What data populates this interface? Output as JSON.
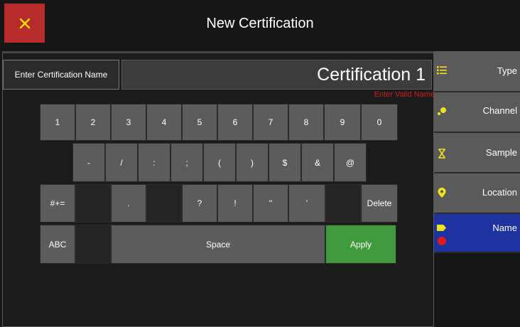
{
  "header": {
    "title": "New Certification",
    "close_icon": "close-icon"
  },
  "name_entry": {
    "label": "Enter Certification Name",
    "value": "Certification 1",
    "error": "Enter Valid Name"
  },
  "keyboard": {
    "row1": [
      "1",
      "2",
      "3",
      "4",
      "5",
      "6",
      "7",
      "8",
      "9",
      "0"
    ],
    "row2": [
      "-",
      "/",
      ":",
      ";",
      "(",
      ")",
      "$",
      "&",
      "@"
    ],
    "row3": [
      "#+=",
      "",
      ".",
      "",
      "?",
      "!",
      "\"",
      "'",
      "",
      "Delete"
    ],
    "row4": {
      "abc": "ABC",
      "space": "Space",
      "apply": "Apply"
    }
  },
  "sidebar": {
    "items": [
      {
        "label": "Type",
        "icon": "list-icon"
      },
      {
        "label": "Channel",
        "icon": "channel-icon"
      },
      {
        "label": "Sample",
        "icon": "hourglass-icon"
      },
      {
        "label": "Location",
        "icon": "location-pin-icon"
      },
      {
        "label": "Name",
        "icon": "tag-icon",
        "active": true
      }
    ]
  },
  "colors": {
    "accent_close": "#b72b2b",
    "apply_green": "#3f9a3b",
    "active_blue": "#1d33a0",
    "icon_yellow": "#f2e21d",
    "error_red": "#c62020"
  }
}
